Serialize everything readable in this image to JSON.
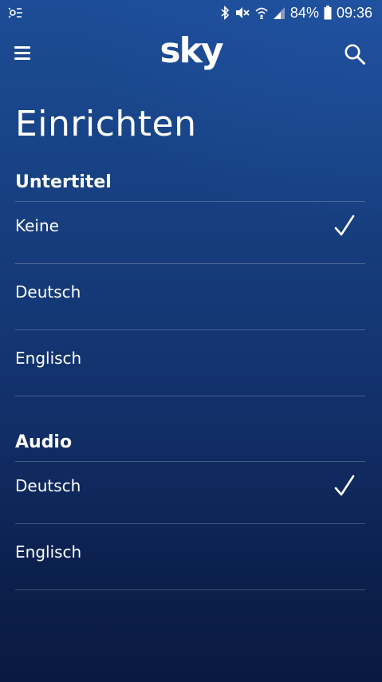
{
  "status_bar": {
    "battery_percent": "84%",
    "time": "09:36"
  },
  "app_bar": {
    "logo_text": "sky",
    "menu_icon": "hamburger-menu-icon",
    "search_icon": "search-icon"
  },
  "page": {
    "title": "Einrichten"
  },
  "subtitles": {
    "heading": "Untertitel",
    "options": [
      {
        "label": "Keine",
        "selected": true
      },
      {
        "label": "Deutsch",
        "selected": false
      },
      {
        "label": "Englisch",
        "selected": false
      }
    ]
  },
  "audio": {
    "heading": "Audio",
    "options": [
      {
        "label": "Deutsch",
        "selected": true
      },
      {
        "label": "Englisch",
        "selected": false
      }
    ]
  },
  "colors": {
    "background_top": "#1c4d96",
    "background_bottom": "#091a40",
    "text": "#ffffff"
  }
}
